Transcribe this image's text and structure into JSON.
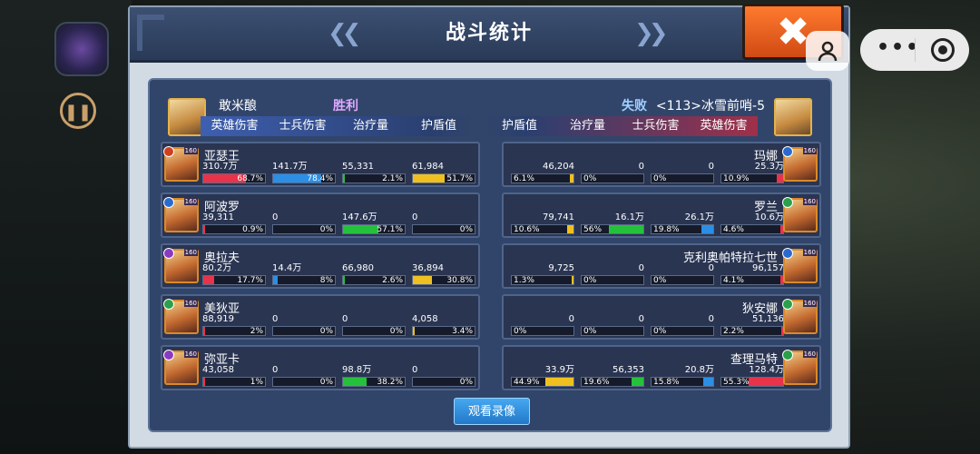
{
  "title": "战斗统计",
  "close_icon": "✖",
  "colors": {
    "hero": "#e8334a",
    "soldier": "#2b8fe6",
    "heal": "#26c13c",
    "shield": "#f0c020"
  },
  "left_team": {
    "name": "敢米酿",
    "result": "胜利"
  },
  "right_team": {
    "name": "<113>冰雪前哨-5",
    "result": "失败"
  },
  "left_tabs": [
    "英雄伤害",
    "士兵伤害",
    "治疗量",
    "护盾值"
  ],
  "right_tabs": [
    "护盾值",
    "治疗量",
    "士兵伤害",
    "英雄伤害"
  ],
  "left_rows": [
    {
      "name": "亚瑟王",
      "level": "160",
      "badge": "#d04020",
      "hero": {
        "v": "310.7万",
        "p": "68.7%",
        "f": 68.7
      },
      "soldier": {
        "v": "141.7万",
        "p": "78.4%",
        "f": 78.4
      },
      "heal": {
        "v": "55,331",
        "p": "2.1%",
        "f": 2.1
      },
      "shield": {
        "v": "61,984",
        "p": "51.7%",
        "f": 51.7
      }
    },
    {
      "name": "阿波罗",
      "level": "160",
      "badge": "#2a6ad0",
      "hero": {
        "v": "39,311",
        "p": "0.9%",
        "f": 0.9
      },
      "soldier": {
        "v": "0",
        "p": "0%",
        "f": 0
      },
      "heal": {
        "v": "147.6万",
        "p": "57.1%",
        "f": 57.1
      },
      "shield": {
        "v": "0",
        "p": "0%",
        "f": 0
      }
    },
    {
      "name": "奥拉夫",
      "level": "160",
      "badge": "#8a3ac0",
      "hero": {
        "v": "80.2万",
        "p": "17.7%",
        "f": 17.7
      },
      "soldier": {
        "v": "14.4万",
        "p": "8%",
        "f": 8
      },
      "heal": {
        "v": "66,980",
        "p": "2.6%",
        "f": 2.6
      },
      "shield": {
        "v": "36,894",
        "p": "30.8%",
        "f": 30.8
      }
    },
    {
      "name": "美狄亚",
      "level": "160",
      "badge": "#2aa04a",
      "hero": {
        "v": "88,919",
        "p": "2%",
        "f": 2
      },
      "soldier": {
        "v": "0",
        "p": "0%",
        "f": 0
      },
      "heal": {
        "v": "0",
        "p": "0%",
        "f": 0
      },
      "shield": {
        "v": "4,058",
        "p": "3.4%",
        "f": 3.4
      }
    },
    {
      "name": "弥亚卡",
      "level": "160",
      "badge": "#8a3ac0",
      "hero": {
        "v": "43,058",
        "p": "1%",
        "f": 1
      },
      "soldier": {
        "v": "0",
        "p": "0%",
        "f": 0
      },
      "heal": {
        "v": "98.8万",
        "p": "38.2%",
        "f": 38.2
      },
      "shield": {
        "v": "0",
        "p": "0%",
        "f": 0
      }
    }
  ],
  "right_rows": [
    {
      "name": "玛娜",
      "level": "160",
      "badge": "#2a6ad0",
      "shield": {
        "v": "46,204",
        "p": "6.1%",
        "f": 6.1
      },
      "heal": {
        "v": "0",
        "p": "0%",
        "f": 0
      },
      "soldier": {
        "v": "0",
        "p": "0%",
        "f": 0
      },
      "hero": {
        "v": "25.3万",
        "p": "10.9%",
        "f": 10.9
      }
    },
    {
      "name": "罗兰",
      "level": "160",
      "badge": "#2aa04a",
      "shield": {
        "v": "79,741",
        "p": "10.6%",
        "f": 10.6
      },
      "heal": {
        "v": "16.1万",
        "p": "56%",
        "f": 56
      },
      "soldier": {
        "v": "26.1万",
        "p": "19.8%",
        "f": 19.8
      },
      "hero": {
        "v": "10.6万",
        "p": "4.6%",
        "f": 4.6
      }
    },
    {
      "name": "克利奥帕特拉七世",
      "level": "160",
      "badge": "#2a6ad0",
      "shield": {
        "v": "9,725",
        "p": "1.3%",
        "f": 1.3
      },
      "heal": {
        "v": "0",
        "p": "0%",
        "f": 0
      },
      "soldier": {
        "v": "0",
        "p": "0%",
        "f": 0
      },
      "hero": {
        "v": "96,157",
        "p": "4.1%",
        "f": 4.1
      }
    },
    {
      "name": "狄安娜",
      "level": "160",
      "badge": "#2aa04a",
      "shield": {
        "v": "0",
        "p": "0%",
        "f": 0
      },
      "heal": {
        "v": "0",
        "p": "0%",
        "f": 0
      },
      "soldier": {
        "v": "0",
        "p": "0%",
        "f": 0
      },
      "hero": {
        "v": "51,136",
        "p": "2.2%",
        "f": 2.2
      }
    },
    {
      "name": "查理马特",
      "level": "160",
      "badge": "#2aa04a",
      "shield": {
        "v": "33.9万",
        "p": "44.9%",
        "f": 44.9
      },
      "heal": {
        "v": "56,353",
        "p": "19.6%",
        "f": 19.6
      },
      "soldier": {
        "v": "20.8万",
        "p": "15.8%",
        "f": 15.8
      },
      "hero": {
        "v": "128.4万",
        "p": "55.3%",
        "f": 55.3
      }
    }
  ],
  "replay_button": "观看录像"
}
